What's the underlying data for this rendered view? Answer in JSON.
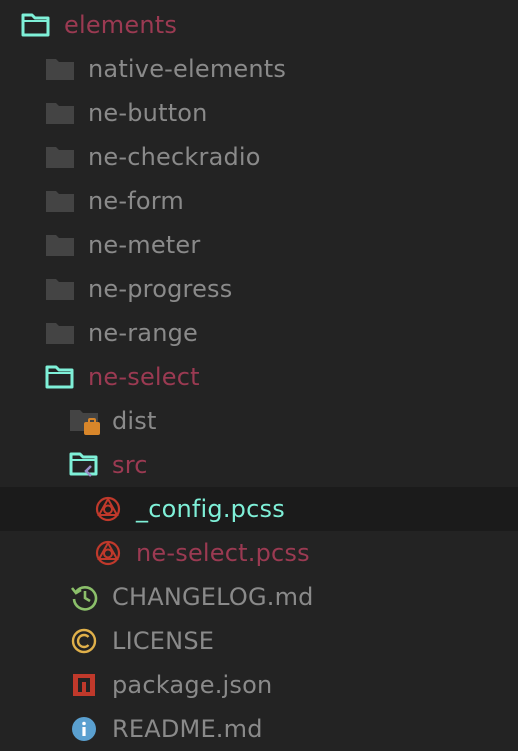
{
  "colors": {
    "folder_gray": "#444444",
    "folder_open": "#7ff0d8",
    "text_gray": "#8a8a8a",
    "text_modified": "#9b3a52",
    "text_active": "#7ff0d8",
    "postcss_red": "#c0392b",
    "changelog_green": "#8bbf6a",
    "license_gold": "#e0b04a",
    "npm_red": "#c0392b",
    "info_blue": "#5aa0d0",
    "dist_badge": "#d8862a",
    "src_badge": "#9a8fc8"
  },
  "tree": [
    {
      "label": "elements",
      "icon": "folder-open-icon",
      "state": "modified"
    },
    {
      "label": "native-elements",
      "icon": "folder-icon",
      "state": "normal"
    },
    {
      "label": "ne-button",
      "icon": "folder-icon",
      "state": "normal"
    },
    {
      "label": "ne-checkradio",
      "icon": "folder-icon",
      "state": "normal"
    },
    {
      "label": "ne-form",
      "icon": "folder-icon",
      "state": "normal"
    },
    {
      "label": "ne-meter",
      "icon": "folder-icon",
      "state": "normal"
    },
    {
      "label": "ne-progress",
      "icon": "folder-icon",
      "state": "normal"
    },
    {
      "label": "ne-range",
      "icon": "folder-icon",
      "state": "normal"
    },
    {
      "label": "ne-select",
      "icon": "folder-open-icon",
      "state": "modified"
    },
    {
      "label": "dist",
      "icon": "folder-dist-icon",
      "state": "normal"
    },
    {
      "label": "src",
      "icon": "folder-src-open-icon",
      "state": "modified"
    },
    {
      "label": "_config.pcss",
      "icon": "postcss-icon",
      "state": "active"
    },
    {
      "label": "ne-select.pcss",
      "icon": "postcss-icon",
      "state": "modified"
    },
    {
      "label": "CHANGELOG.md",
      "icon": "history-icon",
      "state": "normal"
    },
    {
      "label": "LICENSE",
      "icon": "copyright-icon",
      "state": "normal"
    },
    {
      "label": "package.json",
      "icon": "npm-icon",
      "state": "normal"
    },
    {
      "label": "README.md",
      "icon": "info-icon",
      "state": "normal"
    }
  ]
}
